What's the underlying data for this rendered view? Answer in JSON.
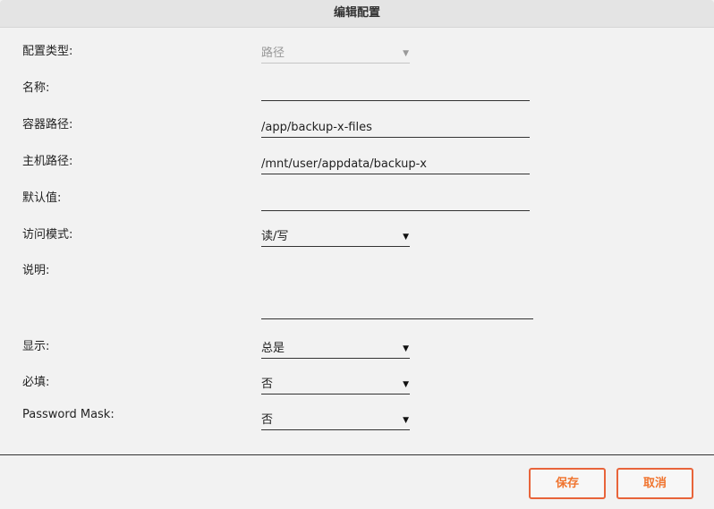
{
  "dialog": {
    "title": "编辑配置",
    "fields": {
      "config_type": {
        "label": "配置类型:",
        "value": "路径"
      },
      "name": {
        "label": "名称:",
        "value": ""
      },
      "container_path": {
        "label": "容器路径:",
        "value": "/app/backup-x-files"
      },
      "host_path": {
        "label": "主机路径:",
        "value": "/mnt/user/appdata/backup-x"
      },
      "default_value": {
        "label": "默认值:",
        "value": ""
      },
      "access_mode": {
        "label": "访问模式:",
        "value": "读/写"
      },
      "description": {
        "label": "说明:",
        "value": ""
      },
      "display": {
        "label": "显示:",
        "value": "总是"
      },
      "required": {
        "label": "必填:",
        "value": "否"
      },
      "password_mask": {
        "label": "Password Mask:",
        "value": "否"
      }
    },
    "buttons": {
      "save": "保存",
      "cancel": "取消"
    }
  },
  "icons": {
    "dropdown_arrow": "▼"
  },
  "colors": {
    "accent": "#e8643a",
    "title_bar": "#e4e4e4",
    "background": "#f2f2f2"
  }
}
